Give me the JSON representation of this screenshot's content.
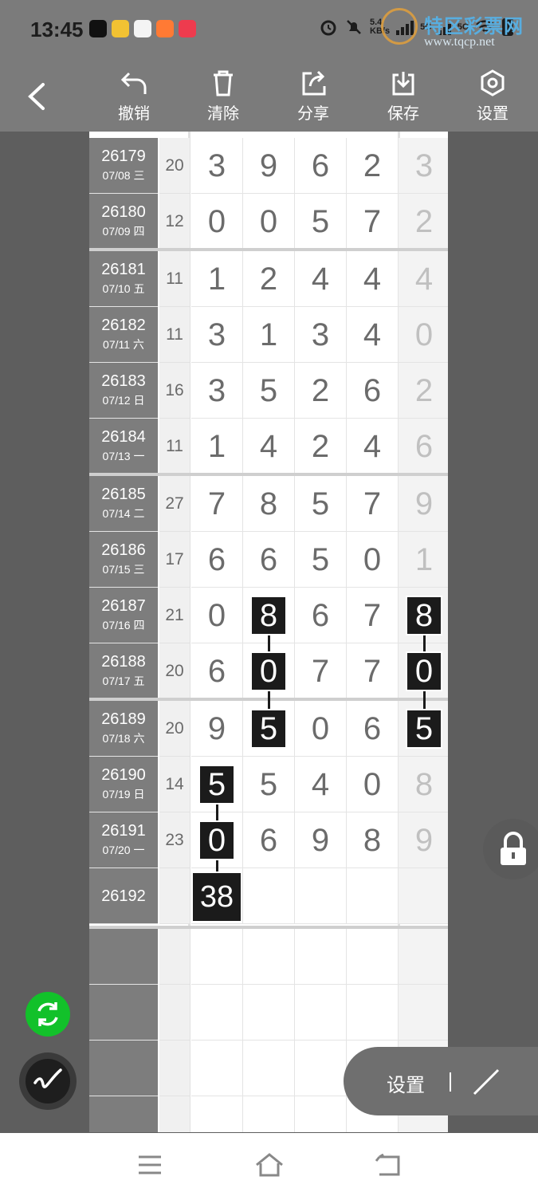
{
  "status_bar": {
    "time": "13:45",
    "speed_value": "5.4",
    "speed_unit": "KB/s",
    "net_1": "5G",
    "net_2": "5G",
    "watermark_title": "特区彩票网",
    "watermark_url": "www.tqcp.net"
  },
  "toolbar": {
    "undo_label": "撤销",
    "clear_label": "清除",
    "share_label": "分享",
    "save_label": "保存",
    "settings_label": "设置"
  },
  "rows": [
    {
      "period": "26179",
      "date": "07/08 三",
      "sum": "20",
      "d": [
        "3",
        "9",
        "6",
        "2",
        "3"
      ]
    },
    {
      "period": "26180",
      "date": "07/09 四",
      "sum": "12",
      "d": [
        "0",
        "0",
        "5",
        "7",
        "2"
      ]
    },
    {
      "period": "26181",
      "date": "07/10 五",
      "sum": "11",
      "d": [
        "1",
        "2",
        "4",
        "4",
        "4"
      ]
    },
    {
      "period": "26182",
      "date": "07/11 六",
      "sum": "11",
      "d": [
        "3",
        "1",
        "3",
        "4",
        "0"
      ]
    },
    {
      "period": "26183",
      "date": "07/12 日",
      "sum": "16",
      "d": [
        "3",
        "5",
        "2",
        "6",
        "2"
      ]
    },
    {
      "period": "26184",
      "date": "07/13 一",
      "sum": "11",
      "d": [
        "1",
        "4",
        "2",
        "4",
        "6"
      ]
    },
    {
      "period": "26185",
      "date": "07/14 二",
      "sum": "27",
      "d": [
        "7",
        "8",
        "5",
        "7",
        "9"
      ]
    },
    {
      "period": "26186",
      "date": "07/15 三",
      "sum": "17",
      "d": [
        "6",
        "6",
        "5",
        "0",
        "1"
      ]
    },
    {
      "period": "26187",
      "date": "07/16 四",
      "sum": "21",
      "d": [
        "0",
        "8",
        "6",
        "7",
        "8"
      ]
    },
    {
      "period": "26188",
      "date": "07/17 五",
      "sum": "20",
      "d": [
        "6",
        "0",
        "7",
        "7",
        "0"
      ]
    },
    {
      "period": "26189",
      "date": "07/18 六",
      "sum": "20",
      "d": [
        "9",
        "5",
        "0",
        "6",
        "5"
      ]
    },
    {
      "period": "26190",
      "date": "07/19 日",
      "sum": "14",
      "d": [
        "5",
        "5",
        "4",
        "0",
        "8"
      ]
    },
    {
      "period": "26191",
      "date": "07/20 一",
      "sum": "23",
      "d": [
        "0",
        "6",
        "9",
        "8",
        "9"
      ]
    },
    {
      "period": "26192",
      "date": "",
      "sum": "",
      "d": [
        "38",
        "",
        "",
        "",
        ""
      ]
    }
  ],
  "settings_pill": {
    "label": "设置"
  }
}
